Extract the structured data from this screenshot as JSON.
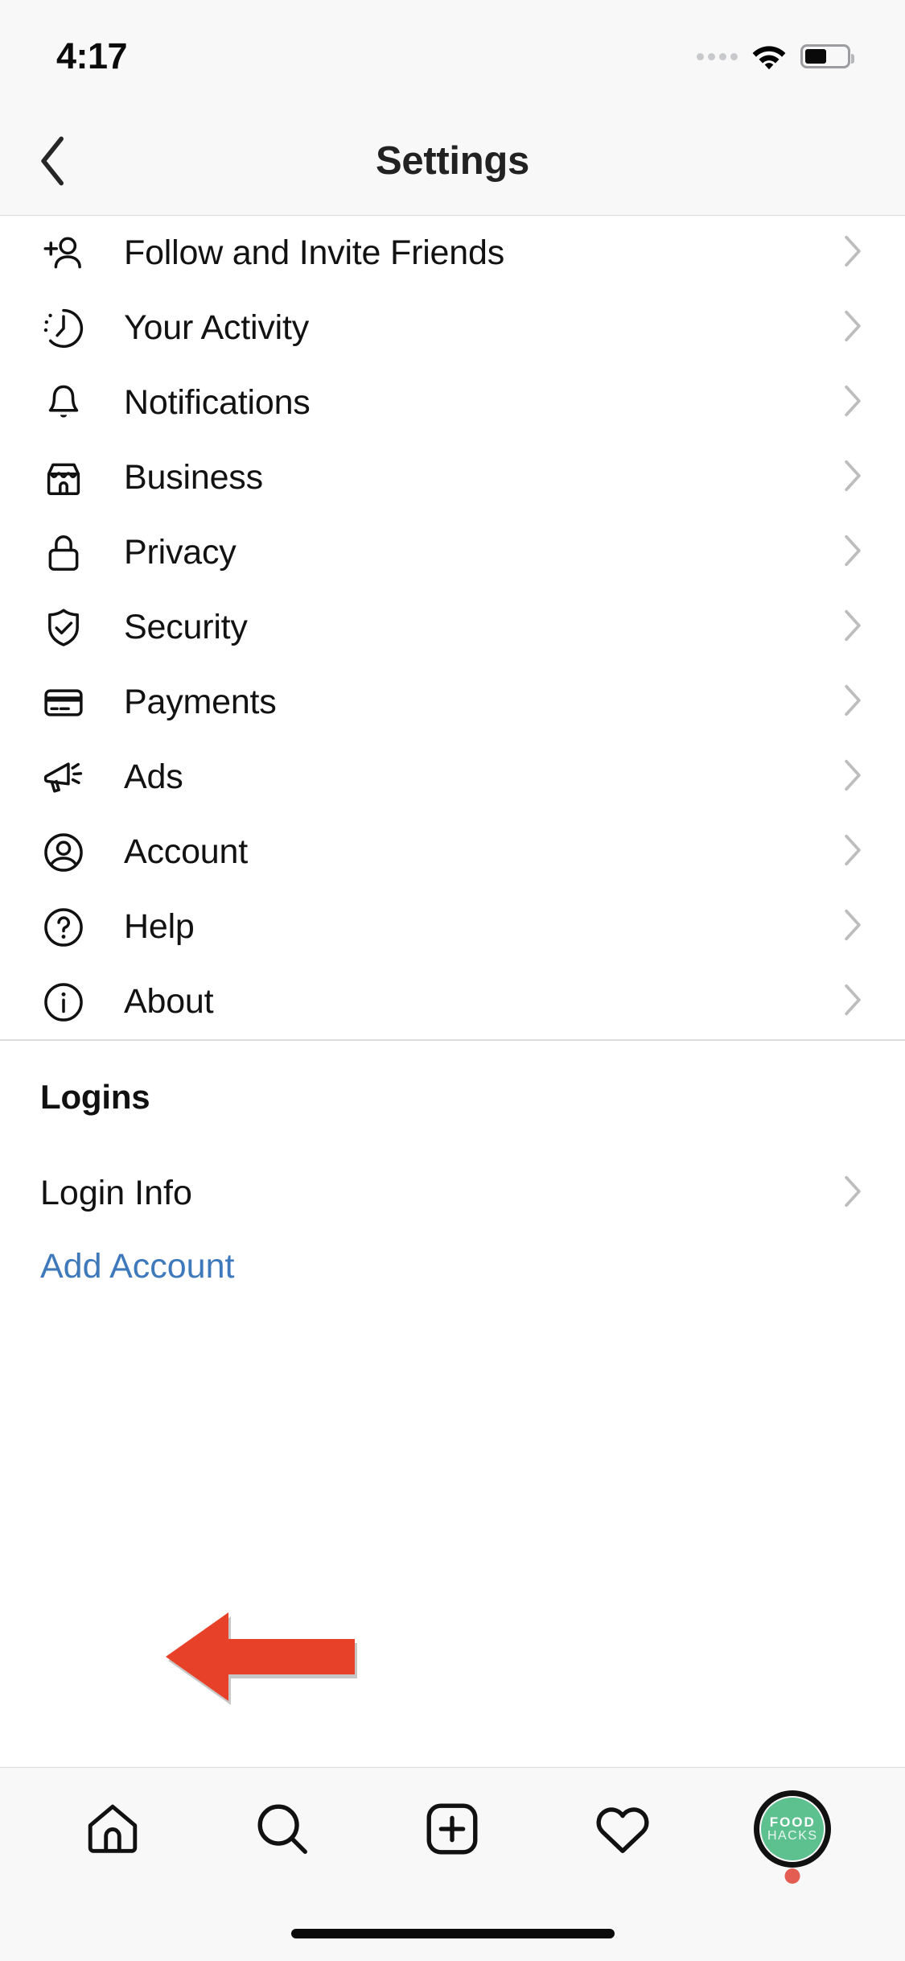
{
  "status_bar": {
    "time": "4:17",
    "signal_icon": "cellular-dots-icon",
    "wifi_icon": "wifi-icon",
    "battery_icon": "battery-icon",
    "battery_level_pct": 52
  },
  "nav": {
    "back_icon": "chevron-left-icon",
    "title": "Settings"
  },
  "settings_list": [
    {
      "label": "Follow and Invite Friends",
      "icon": "person-add-icon",
      "chevron": "chevron-right-icon"
    },
    {
      "label": "Your Activity",
      "icon": "activity-clock-icon",
      "chevron": "chevron-right-icon"
    },
    {
      "label": "Notifications",
      "icon": "bell-icon",
      "chevron": "chevron-right-icon"
    },
    {
      "label": "Business",
      "icon": "storefront-icon",
      "chevron": "chevron-right-icon"
    },
    {
      "label": "Privacy",
      "icon": "lock-icon",
      "chevron": "chevron-right-icon"
    },
    {
      "label": "Security",
      "icon": "shield-check-icon",
      "chevron": "chevron-right-icon"
    },
    {
      "label": "Payments",
      "icon": "credit-card-icon",
      "chevron": "chevron-right-icon"
    },
    {
      "label": "Ads",
      "icon": "megaphone-icon",
      "chevron": "chevron-right-icon"
    },
    {
      "label": "Account",
      "icon": "person-circle-icon",
      "chevron": "chevron-right-icon"
    },
    {
      "label": "Help",
      "icon": "question-circle-icon",
      "chevron": "chevron-right-icon"
    },
    {
      "label": "About",
      "icon": "info-circle-icon",
      "chevron": "chevron-right-icon"
    }
  ],
  "logins_section": {
    "title": "Logins",
    "login_info_label": "Login Info",
    "login_info_chevron": "chevron-right-icon",
    "add_account_label": "Add Account"
  },
  "annotation": {
    "shape": "left-arrow",
    "color": "#E8412A",
    "points_at": "Login Info"
  },
  "tab_bar": {
    "tabs": [
      {
        "name": "home",
        "icon": "home-icon"
      },
      {
        "name": "search",
        "icon": "search-icon"
      },
      {
        "name": "create",
        "icon": "plus-square-icon"
      },
      {
        "name": "activity",
        "icon": "heart-icon"
      },
      {
        "name": "profile",
        "icon": "avatar-icon",
        "active": true
      }
    ],
    "avatar": {
      "line1": "FOOD",
      "line2": "HACKS",
      "background_color": "#5CC08F",
      "badge_color": "#E35D52"
    }
  }
}
